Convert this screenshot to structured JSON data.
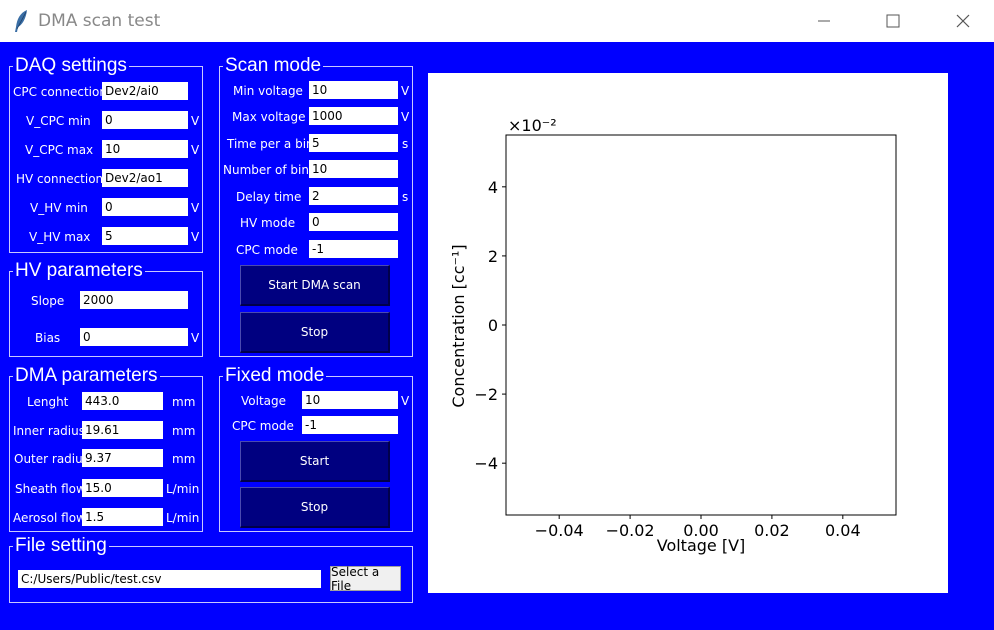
{
  "window": {
    "title": "DMA scan test"
  },
  "daq": {
    "title": "DAQ settings",
    "cpc_connection": {
      "label": "CPC connection",
      "value": "Dev2/ai0"
    },
    "v_cpc_min": {
      "label": "V_CPC min",
      "value": "0",
      "unit": "V"
    },
    "v_cpc_max": {
      "label": "V_CPC max",
      "value": "10",
      "unit": "V"
    },
    "hv_connection": {
      "label": "HV connection",
      "value": "Dev2/ao1"
    },
    "v_hv_min": {
      "label": "V_HV min",
      "value": "0",
      "unit": "V"
    },
    "v_hv_max": {
      "label": "V_HV max",
      "value": "5",
      "unit": "V"
    }
  },
  "hv": {
    "title": "HV parameters",
    "slope": {
      "label": "Slope",
      "value": "2000"
    },
    "bias": {
      "label": "Bias",
      "value": "0",
      "unit": "V"
    }
  },
  "dma": {
    "title": "DMA parameters",
    "length": {
      "label": "Lenght",
      "value": "443.0",
      "unit": "mm"
    },
    "inner_radius": {
      "label": "Inner radiusr",
      "value": "19.61",
      "unit": "mm"
    },
    "outer_radius": {
      "label": "Outer radius",
      "value": "9.37",
      "unit": "mm"
    },
    "sheath_flow": {
      "label": "Sheath flow",
      "value": "15.0",
      "unit": "L/min"
    },
    "aerosol_flow": {
      "label": "Aerosol flow",
      "value": "1.5",
      "unit": "L/min"
    }
  },
  "scan": {
    "title": "Scan mode",
    "min_voltage": {
      "label": "Min voltage",
      "value": "10",
      "unit": "V"
    },
    "max_voltage": {
      "label": "Max voltage",
      "value": "1000",
      "unit": "V"
    },
    "time_per_bin": {
      "label": "Time per a bin",
      "value": "5",
      "unit": "s"
    },
    "number_of_bins": {
      "label": "Number of bins",
      "value": "10"
    },
    "delay_time": {
      "label": "Delay time",
      "value": "2",
      "unit": "s"
    },
    "hv_mode": {
      "label": "HV mode",
      "value": "0"
    },
    "cpc_mode": {
      "label": "CPC mode",
      "value": "-1"
    },
    "start_label": "Start DMA scan",
    "stop_label": "Stop"
  },
  "fixed": {
    "title": "Fixed mode",
    "voltage": {
      "label": "Voltage",
      "value": "10",
      "unit": "V"
    },
    "cpc_mode": {
      "label": "CPC mode",
      "value": "-1"
    },
    "start_label": "Start",
    "stop_label": "Stop"
  },
  "file": {
    "title": "File setting",
    "path": "C:/Users/Public/test.csv",
    "select_label": "Select a File"
  },
  "chart_data": {
    "type": "scatter",
    "series": [],
    "xlabel": "Voltage [V]",
    "ylabel": "Concentration [cc⁻¹]",
    "y_offset_text": "×10⁻²",
    "xlim": [
      -0.055,
      0.055
    ],
    "ylim": [
      -0.055,
      0.055
    ],
    "x_ticks": [
      -0.04,
      -0.02,
      0.0,
      0.02,
      0.04
    ],
    "x_tick_labels": [
      "−0.04",
      "−0.02",
      "0.00",
      "0.02",
      "0.04"
    ],
    "y_ticks": [
      -0.04,
      -0.02,
      0.0,
      0.02,
      0.04
    ],
    "y_tick_labels": [
      "−4",
      "−2",
      "0",
      "2",
      "4"
    ],
    "grid": false
  }
}
